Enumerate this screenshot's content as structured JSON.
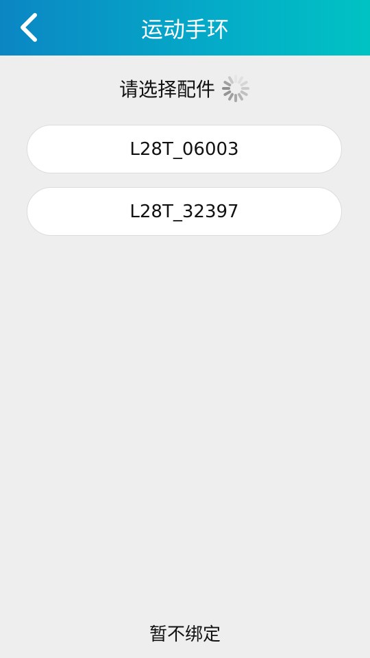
{
  "header": {
    "title": "运动手环",
    "back_icon": "chevron-left-icon",
    "gradient_colors": [
      "#0b86c3",
      "#00c2c3"
    ]
  },
  "subtitle": {
    "text": "请选择配件",
    "spinner_icon": "loading-spinner-icon"
  },
  "devices": [
    {
      "name": "L28T_06003"
    },
    {
      "name": "L28T_32397"
    }
  ],
  "footer": {
    "skip_label": "暂不绑定"
  }
}
